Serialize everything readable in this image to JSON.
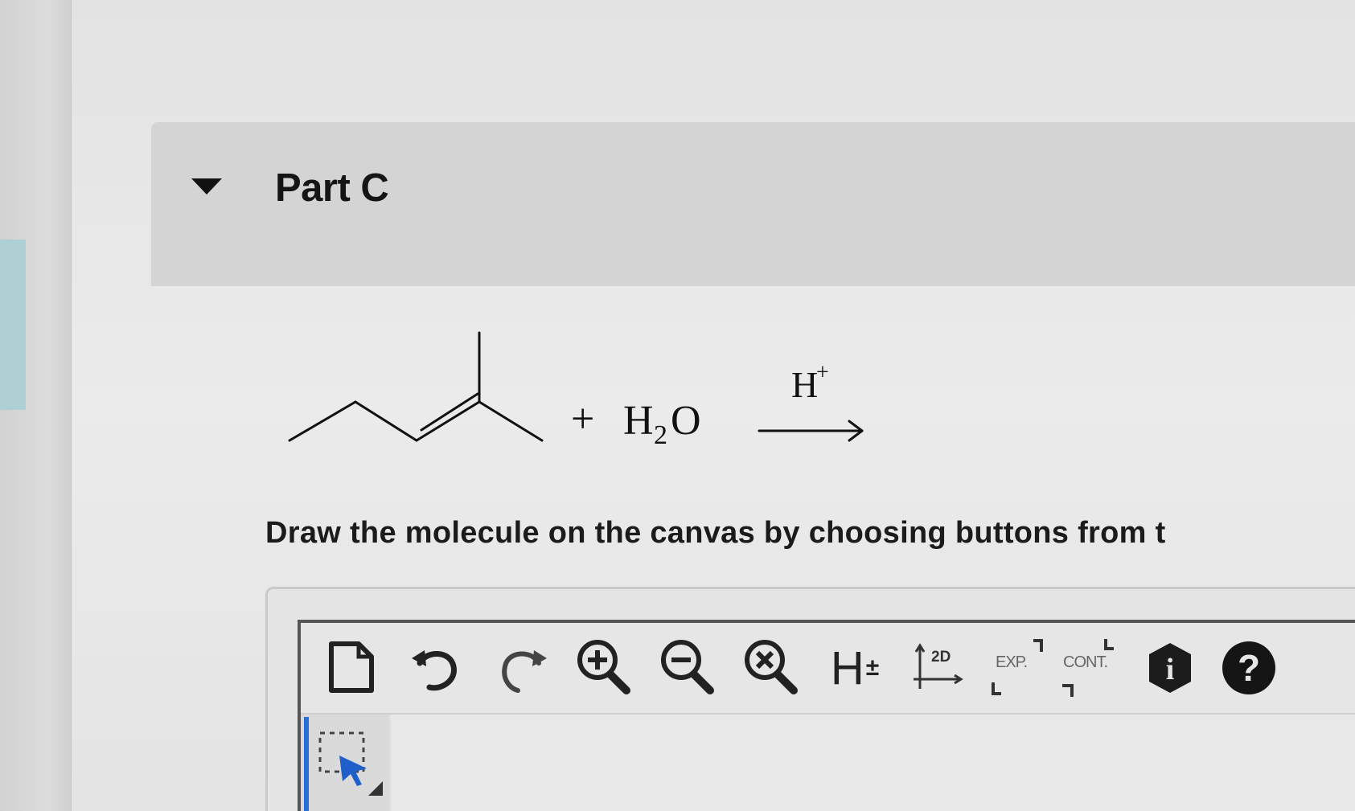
{
  "part": {
    "title": "Part C",
    "collapse_icon": "triangle-down-icon"
  },
  "reaction": {
    "plus": "+",
    "reagent_main": "H",
    "reagent_sub": "2",
    "reagent_tail": "O",
    "catalyst_main": "H",
    "catalyst_sup": "+",
    "reactant_structure": "2-methyl-2-pentene skeletal structure"
  },
  "instructions": "Draw the molecule on the canvas by choosing buttons from t",
  "toolbar": {
    "new_icon": "document-icon",
    "undo_icon": "undo-icon",
    "redo_icon": "redo-icon",
    "zoom_in_icon": "zoom-in-icon",
    "zoom_out_icon": "zoom-out-icon",
    "zoom_reset_icon": "zoom-reset-icon",
    "hydrogen_label": "H",
    "hydrogen_pm": "±",
    "clean2d_label": "2D",
    "expand_label": "EXP.",
    "contract_label": "CONT.",
    "info_label": "i",
    "help_label": "?"
  },
  "side_tools": {
    "select_icon": "select-arrow-icon"
  },
  "colors": {
    "select_accent": "#2a6fd8",
    "header_bg": "#d4d4d4"
  }
}
